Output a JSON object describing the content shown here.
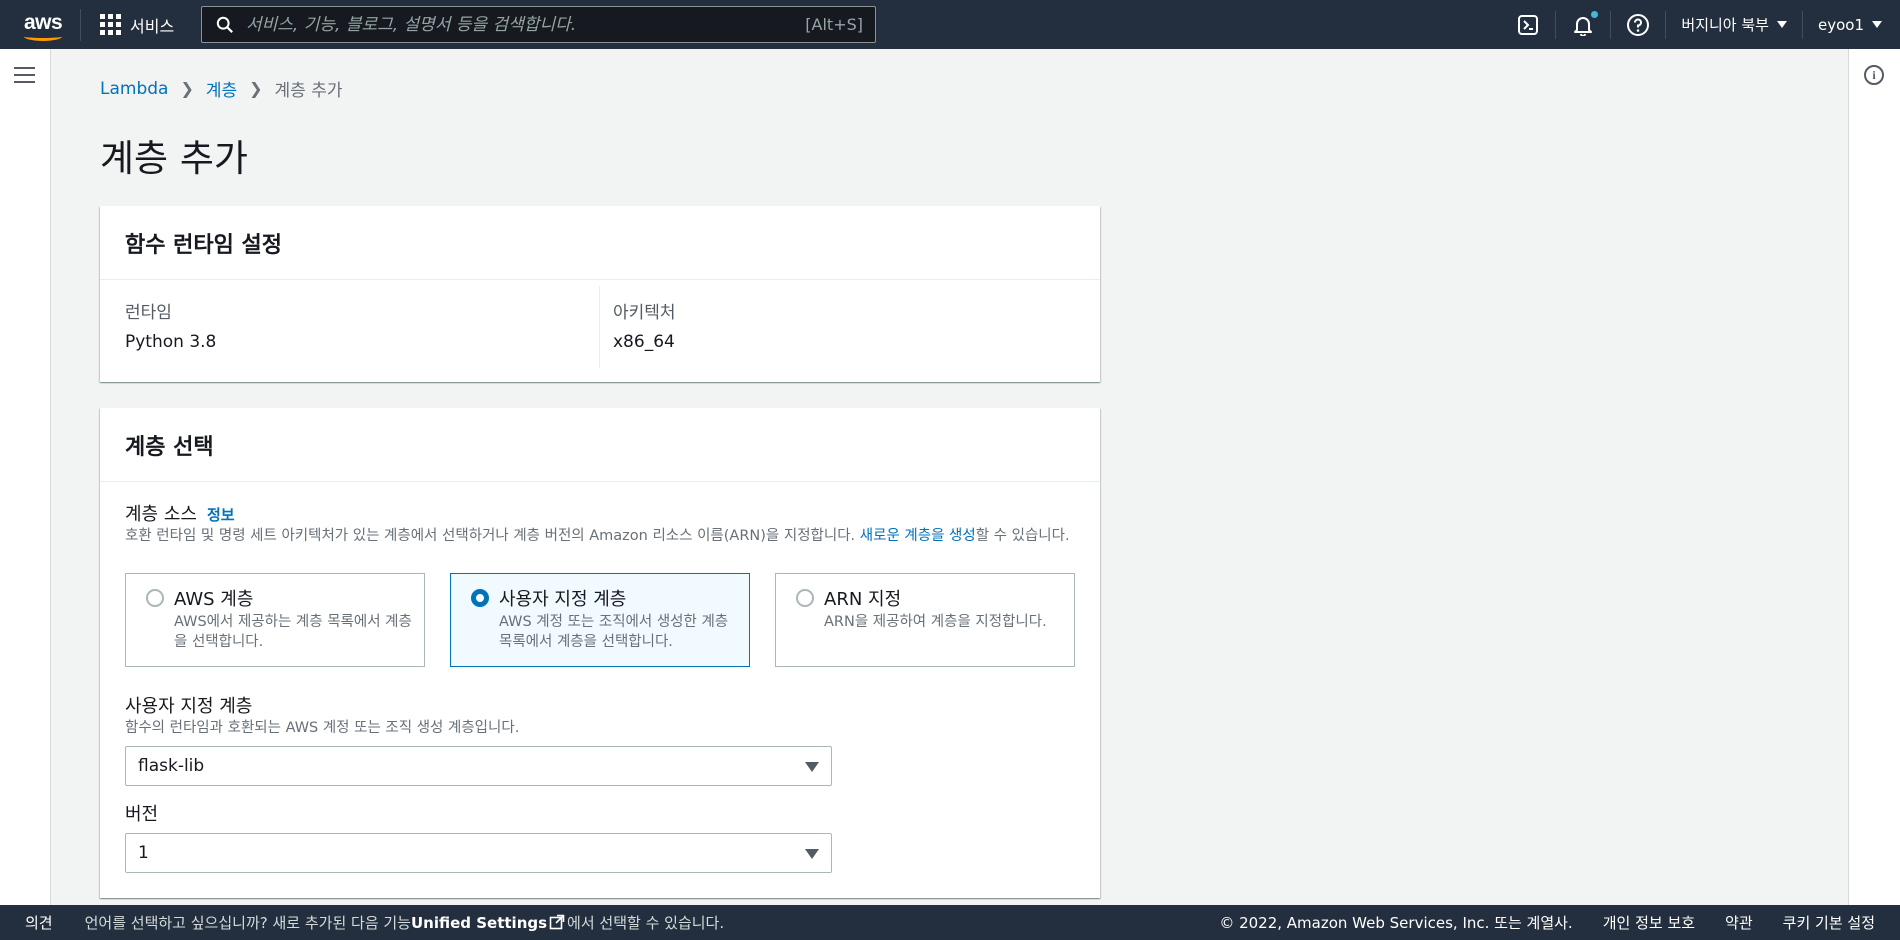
{
  "nav": {
    "logo_text": "aws",
    "services_label": "서비스",
    "search_placeholder": "서비스, 기능, 블로그, 설명서 등을 검색합니다.",
    "search_shortcut": "[Alt+S]",
    "region": "버지니아 북부",
    "account": "eyoo1"
  },
  "breadcrumb": {
    "items": [
      "Lambda",
      "계층",
      "계층 추가"
    ]
  },
  "page_title": "계층 추가",
  "runtime_card": {
    "title": "함수 런타임 설정",
    "runtime_label": "런타임",
    "runtime_value": "Python 3.8",
    "arch_label": "아키텍처",
    "arch_value": "x86_64"
  },
  "layer_card": {
    "title": "계층 선택",
    "source_label": "계층 소스",
    "info_link": "정보",
    "source_desc_1": "호환 런타임 및 명령 세트 아키텍처가 있는 계층에서 선택하거나 계층 버전의 Amazon 리소스 이름(ARN)을 지정합니다. ",
    "source_desc_link": "새로운 계층을 생성",
    "source_desc_2": "할 수 있습니다.",
    "options": [
      {
        "title": "AWS 계층",
        "desc": "AWS에서 제공하는 계층 목록에서 계층을 선택합니다.",
        "selected": false
      },
      {
        "title": "사용자 지정 계층",
        "desc": "AWS 계정 또는 조직에서 생성한 계층 목록에서 계층을 선택합니다.",
        "selected": true
      },
      {
        "title": "ARN 지정",
        "desc": "ARN을 제공하여 계층을 지정합니다.",
        "selected": false
      }
    ],
    "custom_label": "사용자 지정 계층",
    "custom_desc": "함수의 런타임과 호환되는 AWS 계정 또는 조직 생성 계층입니다.",
    "custom_value": "flask-lib",
    "version_label": "버전",
    "version_value": "1"
  },
  "footer": {
    "feedback": "의견",
    "lang_1": "언어를 선택하고 싶으십니까? 새로 추가된 다음 기능",
    "lang_bold": "Unified Settings",
    "lang_2": "에서 선택할 수 있습니다.",
    "copyright": "© 2022, Amazon Web Services, Inc. 또는 계열사.",
    "privacy": "개인 정보 보호",
    "terms": "약관",
    "cookies": "쿠키 기본 설정"
  },
  "colors": {
    "nav_bg": "#232f3e",
    "link": "#0073bb",
    "selected_bg": "#f1faff",
    "notification_dot": "#44b9d6",
    "logo_smile": "#ff9900"
  }
}
